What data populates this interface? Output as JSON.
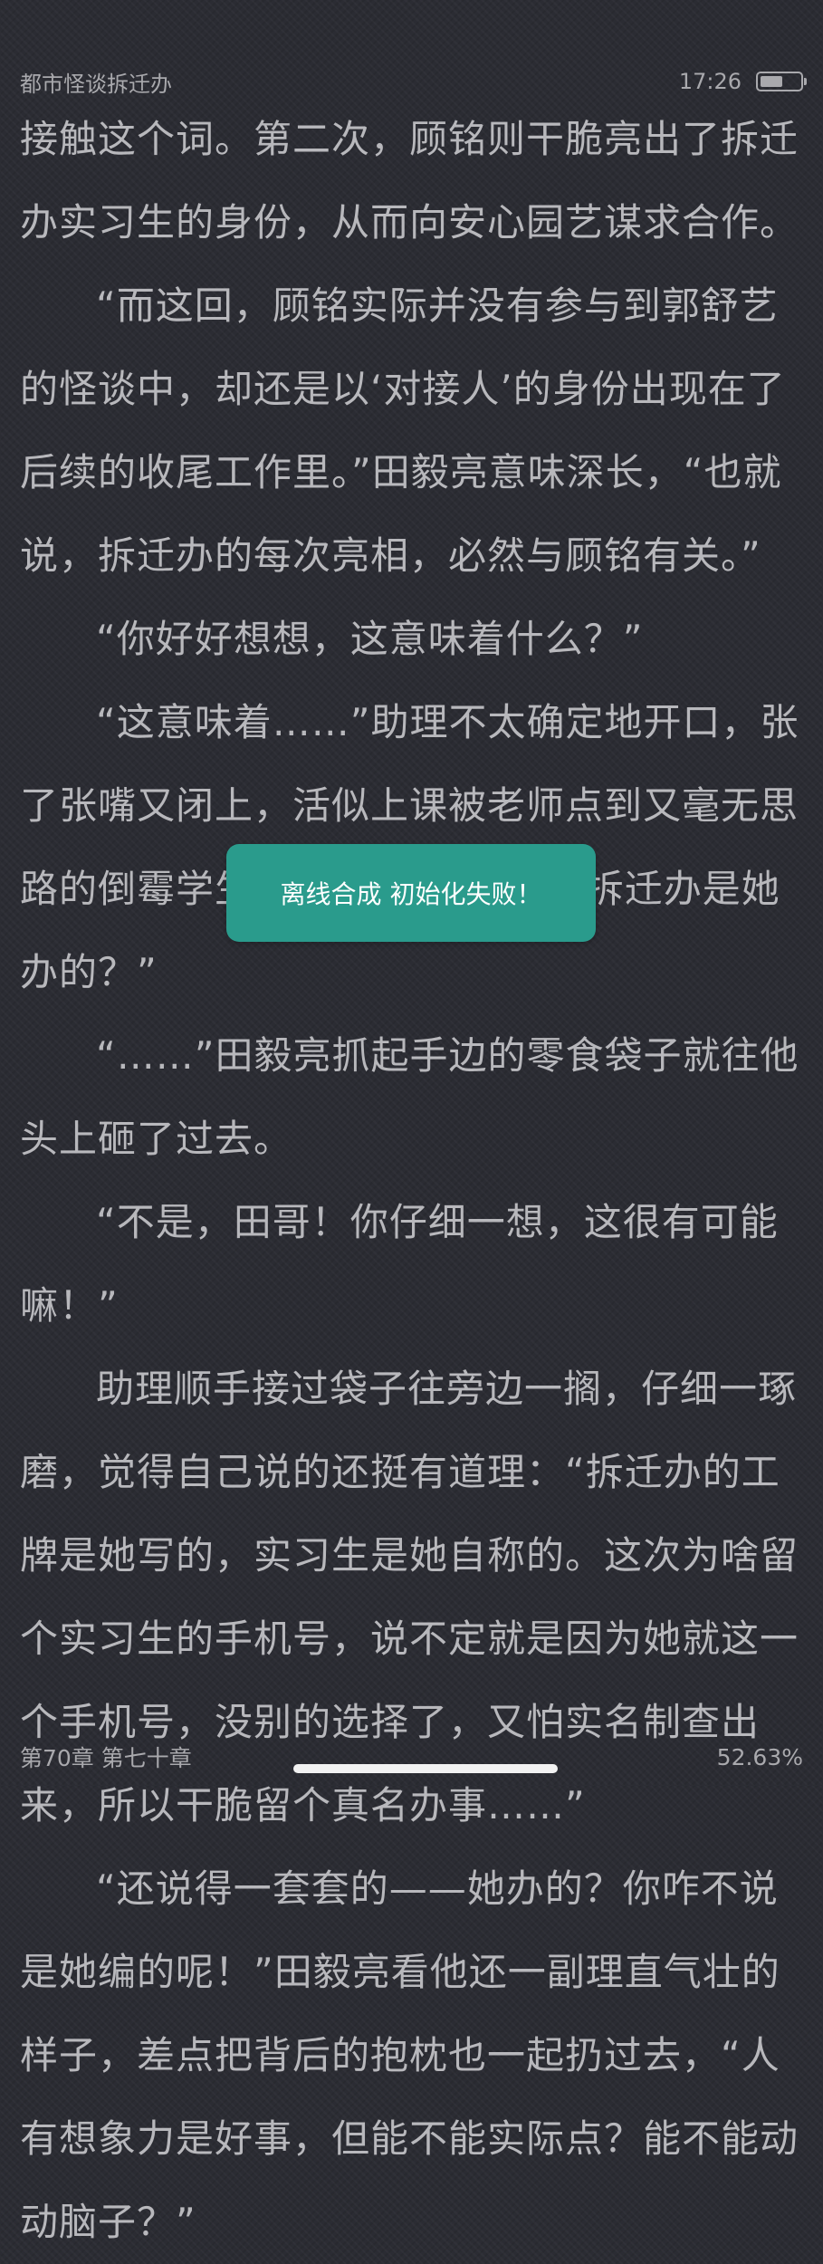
{
  "status_bar": {
    "book_title": "都市怪谈拆迁办",
    "time": "17:26",
    "battery_level": 0.6
  },
  "paragraphs": [
    "接触这个词。第二次，顾铭则干脆亮出了拆迁办实习生的身份，从而向安心园艺谋求合作。",
    "“而这回，顾铭实际并没有参与到郭舒艺的怪谈中，却还是以‘对接人’的身份出现在了后续的收尾工作里。”田毅亮意味深长，“也就说，拆迁办的每次亮相，必然与顾铭有关。”",
    "“你好好想想，这意味着什么？”",
    "“这意味着……”助理不太确定地开口，张了张嘴又闭上，活似上课被老师点到又毫无思路的倒霉学生，“可能意味着……拆迁办是她办的？”",
    "“……”田毅亮抓起手边的零食袋子就往他头上砸了过去。",
    "“不是，田哥！你仔细一想，这很有可能嘛！”",
    "助理顺手接过袋子往旁边一搁，仔细一琢磨，觉得自己说的还挺有道理：“拆迁办的工牌是她写的，实习生是她自称的。这次为啥留个实习生的手机号，说不定就是因为她就这一个手机号，没别的选择了，又怕实名制查出来，所以干脆留个真名办事……”",
    "“还说得一套套的——她办的？你咋不说是她编的呢！”田毅亮看他还一副理直气壮的样子，差点把背后的抱枕也一起扔过去，“人有想象力是好事，但能不能实际点？能不能动动脑子？”"
  ],
  "toast": {
    "message": "离线合成 初始化失败！"
  },
  "footer": {
    "chapter": "第70章 第七十章",
    "progress": "52.63%"
  }
}
